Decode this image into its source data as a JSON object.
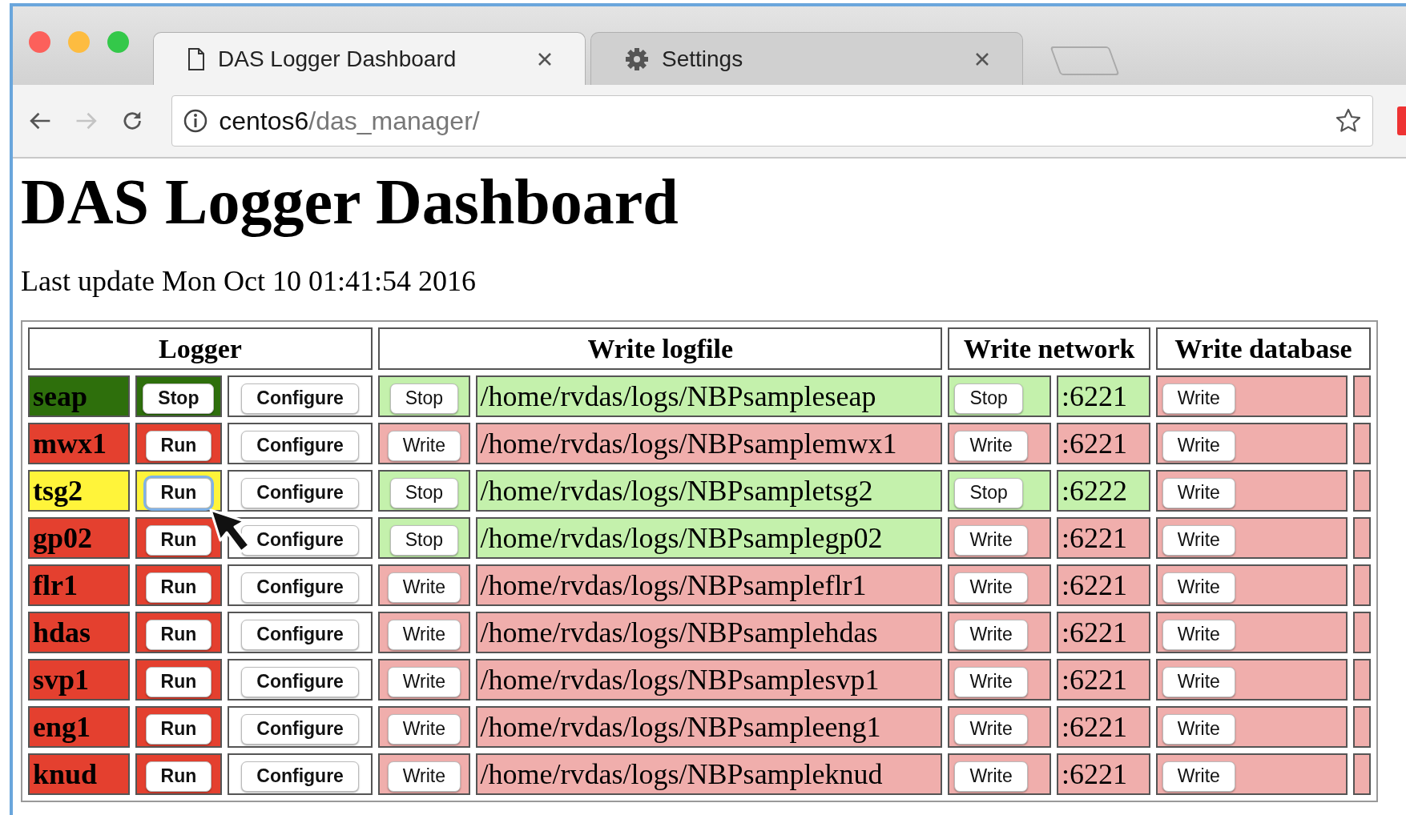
{
  "browser": {
    "tabs": [
      {
        "title": "DAS Logger Dashboard",
        "kind": "page",
        "selected": true
      },
      {
        "title": "Settings",
        "kind": "settings",
        "selected": false
      }
    ],
    "address": {
      "host": "centos6",
      "path": "/das_manager/"
    }
  },
  "page": {
    "title": "DAS Logger Dashboard",
    "last_update": "Last update Mon Oct 10 01:41:54 2016"
  },
  "table": {
    "column_groups": [
      "Logger",
      "Write logfile",
      "Write network",
      "Write database"
    ],
    "rows": [
      {
        "name": "seap",
        "color": "#2e6f0c",
        "logger_button": "Stop",
        "focused": false,
        "configure_button": "Configure",
        "logfile": {
          "on": true,
          "button": "Stop",
          "path": "/home/rvdas/logs/NBPsampleseap"
        },
        "network": {
          "on": true,
          "button": "Stop",
          "port": ":6221"
        },
        "database": {
          "on": false,
          "button": "Write"
        }
      },
      {
        "name": "mwx1",
        "color": "#e4402f",
        "logger_button": "Run",
        "focused": false,
        "configure_button": "Configure",
        "logfile": {
          "on": false,
          "button": "Write",
          "path": "/home/rvdas/logs/NBPsamplemwx1"
        },
        "network": {
          "on": false,
          "button": "Write",
          "port": ":6221"
        },
        "database": {
          "on": false,
          "button": "Write"
        }
      },
      {
        "name": "tsg2",
        "color": "#fff43a",
        "logger_button": "Run",
        "focused": true,
        "configure_button": "Configure",
        "logfile": {
          "on": true,
          "button": "Stop",
          "path": "/home/rvdas/logs/NBPsampletsg2"
        },
        "network": {
          "on": true,
          "button": "Stop",
          "port": ":6222"
        },
        "database": {
          "on": false,
          "button": "Write"
        }
      },
      {
        "name": "gp02",
        "color": "#e4402f",
        "logger_button": "Run",
        "focused": false,
        "configure_button": "Configure",
        "logfile": {
          "on": true,
          "button": "Stop",
          "path": "/home/rvdas/logs/NBPsamplegp02"
        },
        "network": {
          "on": false,
          "button": "Write",
          "port": ":6221"
        },
        "database": {
          "on": false,
          "button": "Write"
        }
      },
      {
        "name": "flr1",
        "color": "#e4402f",
        "logger_button": "Run",
        "focused": false,
        "configure_button": "Configure",
        "logfile": {
          "on": false,
          "button": "Write",
          "path": "/home/rvdas/logs/NBPsampleflr1"
        },
        "network": {
          "on": false,
          "button": "Write",
          "port": ":6221"
        },
        "database": {
          "on": false,
          "button": "Write"
        }
      },
      {
        "name": "hdas",
        "color": "#e4402f",
        "logger_button": "Run",
        "focused": false,
        "configure_button": "Configure",
        "logfile": {
          "on": false,
          "button": "Write",
          "path": "/home/rvdas/logs/NBPsamplehdas"
        },
        "network": {
          "on": false,
          "button": "Write",
          "port": ":6221"
        },
        "database": {
          "on": false,
          "button": "Write"
        }
      },
      {
        "name": "svp1",
        "color": "#e4402f",
        "logger_button": "Run",
        "focused": false,
        "configure_button": "Configure",
        "logfile": {
          "on": false,
          "button": "Write",
          "path": "/home/rvdas/logs/NBPsamplesvp1"
        },
        "network": {
          "on": false,
          "button": "Write",
          "port": ":6221"
        },
        "database": {
          "on": false,
          "button": "Write"
        }
      },
      {
        "name": "eng1",
        "color": "#e4402f",
        "logger_button": "Run",
        "focused": false,
        "configure_button": "Configure",
        "logfile": {
          "on": false,
          "button": "Write",
          "path": "/home/rvdas/logs/NBPsampleeng1"
        },
        "network": {
          "on": false,
          "button": "Write",
          "port": ":6221"
        },
        "database": {
          "on": false,
          "button": "Write"
        }
      },
      {
        "name": "knud",
        "color": "#e4402f",
        "logger_button": "Run",
        "focused": false,
        "configure_button": "Configure",
        "logfile": {
          "on": false,
          "button": "Write",
          "path": "/home/rvdas/logs/NBPsampleknud"
        },
        "network": {
          "on": false,
          "button": "Write",
          "port": ":6221"
        },
        "database": {
          "on": false,
          "button": "Write"
        }
      }
    ]
  }
}
